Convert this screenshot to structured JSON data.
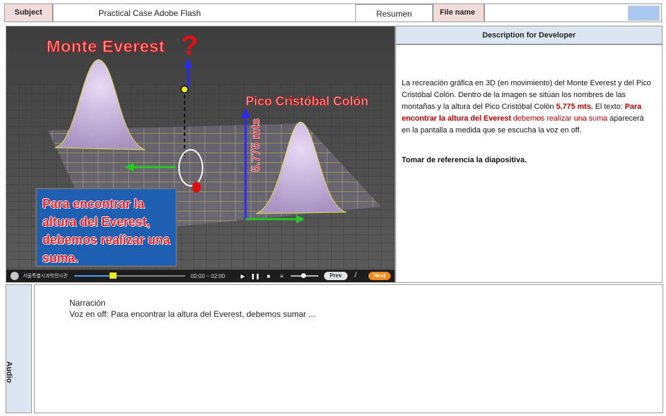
{
  "header": {
    "subject_label": "Subject",
    "subject_value": "Practical Case Adobe Flash",
    "resumen_label": "Resumen",
    "filename_label": "File name"
  },
  "media": {
    "title_everest": "Monte Everest",
    "title_cristobal": "Pico Cristóbal Colón",
    "question_mark": "?",
    "height_label": "5.775 mts",
    "caption": "Para encontrar la altura del Everest, debemos realizar una suma."
  },
  "player": {
    "org_name": "서울특별시과학전시관",
    "time": "00:00 ~ 02:00",
    "prev_label": "Prev",
    "separator": "/",
    "next_label": "Next",
    "progress": 0.35,
    "volume": 0.45
  },
  "description": {
    "header": "Description for Developer",
    "p1_a": "La recreación gráfica en 3D (en movimiento) del Monte Everest y del Pico Cristóbal Colón. Dentro de la imagen se sitúan los nombres de las montañas y la altura del Pico Cristóbal Colón ",
    "p1_height": "5.775 mts.",
    "p1_b": " El texto: ",
    "p1_quote": "Para encontrar la altura del Everest",
    "p1_quote2": " debemos realizar una suma",
    "p1_c": " aparecerá en la pantalla a medida que se escucha la voz en off.",
    "reference": "Tomar de referencia la diapositiva."
  },
  "audio": {
    "label": "Audio",
    "narration_title": "Narración",
    "narration_line": "Voz en off: Para encontrar la altura del Everest, debemos sumar ..."
  },
  "colors": {
    "pink_label": "#f2dcdb",
    "blue_header": "#dce6f2",
    "caption_bg": "#1e5fb2",
    "caption_text": "#ee1c24",
    "next_button": "#f08a1e"
  }
}
